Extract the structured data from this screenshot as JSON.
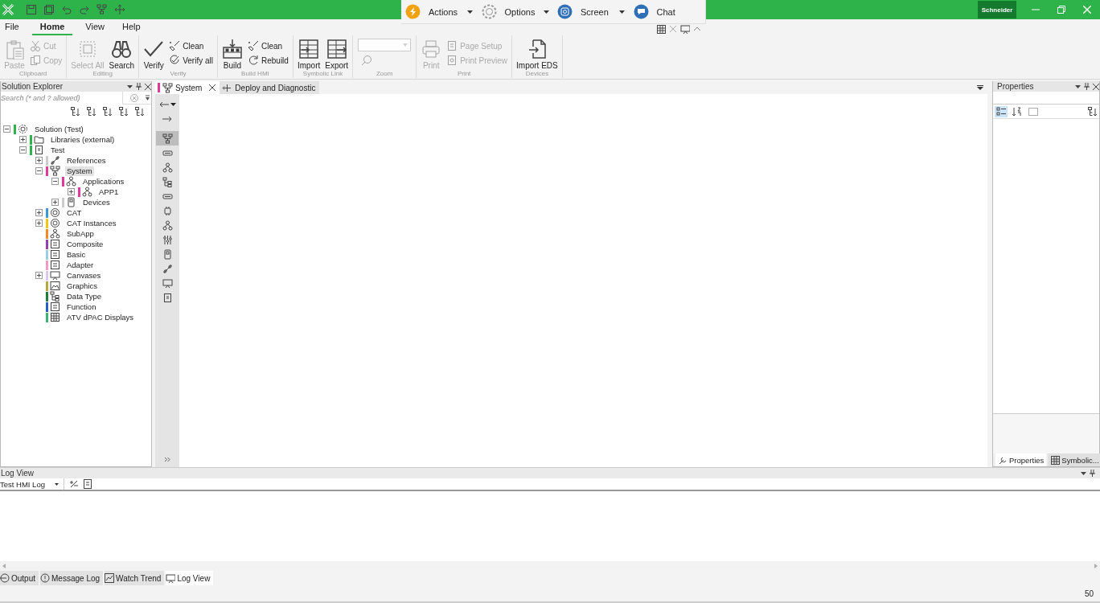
{
  "title_bar": {
    "logo_text": "Schneider"
  },
  "floating_toolbar": {
    "items": [
      {
        "label": "Actions",
        "kind": "dropdown"
      },
      {
        "label": "Options",
        "kind": "dropdown"
      },
      {
        "label": "Screen",
        "kind": "dropdown"
      },
      {
        "label": "Chat",
        "kind": "button"
      }
    ]
  },
  "menu": [
    {
      "label": "File",
      "selected": false
    },
    {
      "label": "Home",
      "selected": true
    },
    {
      "label": "View",
      "selected": false
    },
    {
      "label": "Help",
      "selected": false
    }
  ],
  "ribbon": [
    {
      "label": "Clipboard",
      "buttons": [
        {
          "label": "Paste",
          "kind": "large",
          "disabled": true
        },
        {
          "label": "Cut",
          "kind": "small",
          "disabled": true
        },
        {
          "label": "Copy",
          "kind": "small",
          "disabled": true
        }
      ]
    },
    {
      "label": "Editing",
      "buttons": [
        {
          "label": "Select All",
          "kind": "large",
          "disabled": true
        },
        {
          "label": "Search",
          "kind": "large",
          "disabled": false
        }
      ]
    },
    {
      "label": "Verify",
      "buttons": [
        {
          "label": "Verify",
          "kind": "large",
          "disabled": false
        },
        {
          "label": "Clean",
          "kind": "small",
          "disabled": false
        },
        {
          "label": "Verify all",
          "kind": "small",
          "disabled": false
        }
      ]
    },
    {
      "label": "Build HMI",
      "buttons": [
        {
          "label": "Build",
          "kind": "large",
          "disabled": false
        },
        {
          "label": "Clean",
          "kind": "small",
          "disabled": false
        },
        {
          "label": "Rebuild",
          "kind": "small",
          "disabled": false
        }
      ]
    },
    {
      "label": "Symbolic Link",
      "buttons": [
        {
          "label": "Import",
          "kind": "large",
          "disabled": false
        },
        {
          "label": "Export",
          "kind": "large",
          "disabled": false
        }
      ]
    },
    {
      "label": "Zoom",
      "buttons": [
        {
          "kind": "combo",
          "disabled": true
        },
        {
          "kind": "zoom",
          "disabled": true
        }
      ]
    },
    {
      "label": "Print",
      "buttons": [
        {
          "label": "Print",
          "kind": "large",
          "disabled": true
        },
        {
          "label": "Page Setup",
          "kind": "small",
          "disabled": true
        },
        {
          "label": "Print Preview",
          "kind": "small",
          "disabled": true
        }
      ]
    },
    {
      "label": "Devices",
      "buttons": [
        {
          "label": "Import EDS",
          "kind": "large",
          "disabled": false
        }
      ]
    }
  ],
  "solution_explorer": {
    "title": "Solution Explorer",
    "search": {
      "placeholder": "Search (* and ? allowed)"
    },
    "tree": [
      {
        "label": "Solution  (Test)",
        "kind": "node",
        "expanded": true,
        "selected": false,
        "color": "#2db34a",
        "children": [
          {
            "label": "Libraries (external)",
            "kind": "node",
            "expanded": false,
            "selected": false,
            "color": "#2db34a"
          },
          {
            "label": "Test",
            "kind": "node",
            "expanded": true,
            "selected": false,
            "color": "#2db34a",
            "children": [
              {
                "label": "References",
                "kind": "node",
                "expanded": false,
                "selected": false,
                "color": "#cccccc"
              },
              {
                "label": "System",
                "kind": "node",
                "expanded": true,
                "selected": true,
                "color": "#e0399a",
                "children": [
                  {
                    "label": "Applications",
                    "kind": "node",
                    "expanded": true,
                    "selected": false,
                    "color": "#e0399a",
                    "children": [
                      {
                        "label": "APP1",
                        "kind": "node",
                        "expanded": false,
                        "selected": false,
                        "color": "#e0399a"
                      }
                    ]
                  },
                  {
                    "label": "Devices",
                    "kind": "node",
                    "expanded": false,
                    "selected": false,
                    "color": "#cccccc"
                  }
                ]
              },
              {
                "label": "CAT",
                "kind": "node",
                "expanded": false,
                "selected": false,
                "color": "#3a9ad9"
              },
              {
                "label": "CAT Instances",
                "kind": "node",
                "expanded": false,
                "selected": false,
                "color": "#f5c518"
              },
              {
                "label": "SubApp",
                "kind": "leaf",
                "selected": false,
                "color": "#f08a24"
              },
              {
                "label": "Composite",
                "kind": "leaf",
                "selected": false,
                "color": "#8e44ad"
              },
              {
                "label": "Basic",
                "kind": "leaf",
                "selected": false,
                "color": "#9ccbe8"
              },
              {
                "label": "Adapter",
                "kind": "leaf",
                "selected": false,
                "color": "#f29ac6"
              },
              {
                "label": "Canvases",
                "kind": "node",
                "expanded": false,
                "selected": false,
                "color": "#d9c8f0"
              },
              {
                "label": "Graphics",
                "kind": "leaf",
                "selected": false,
                "color": "#b5a642"
              },
              {
                "label": "Data Type",
                "kind": "leaf",
                "selected": false,
                "color": "#1e7d3a"
              },
              {
                "label": "Function",
                "kind": "leaf",
                "selected": false,
                "color": "#2a5cc8"
              },
              {
                "label": "ATV dPAC Displays",
                "kind": "leaf",
                "selected": false,
                "color": "#3cb371"
              }
            ]
          }
        ]
      }
    ]
  },
  "editor": {
    "tabs": [
      {
        "label": "System",
        "selected": true
      },
      {
        "label": "Deploy and Diagnostic",
        "selected": false
      }
    ],
    "tools": [
      {
        "selected": true
      },
      {
        "selected": false
      },
      {
        "selected": false
      },
      {
        "selected": false
      },
      {
        "selected": false
      },
      {
        "selected": false
      },
      {
        "selected": false
      },
      {
        "selected": false
      },
      {
        "selected": false
      },
      {
        "selected": false
      },
      {
        "selected": false
      },
      {
        "selected": false
      }
    ]
  },
  "properties": {
    "title": "Properties",
    "view_buttons": [
      {
        "selected": true
      },
      {
        "selected": false
      }
    ],
    "tabs": [
      {
        "label": "Properties",
        "selected": true
      },
      {
        "label": "Symbolic...",
        "selected": false
      }
    ]
  },
  "log_view": {
    "title": "Log View",
    "log_select": {
      "value": "Test HMI Log"
    },
    "tabs": [
      {
        "label": "Output",
        "selected": false
      },
      {
        "label": "Message Log",
        "selected": false
      },
      {
        "label": "Watch Trend",
        "selected": false
      },
      {
        "label": "Log View",
        "selected": true
      }
    ]
  },
  "status_bar": {
    "text": "50"
  }
}
